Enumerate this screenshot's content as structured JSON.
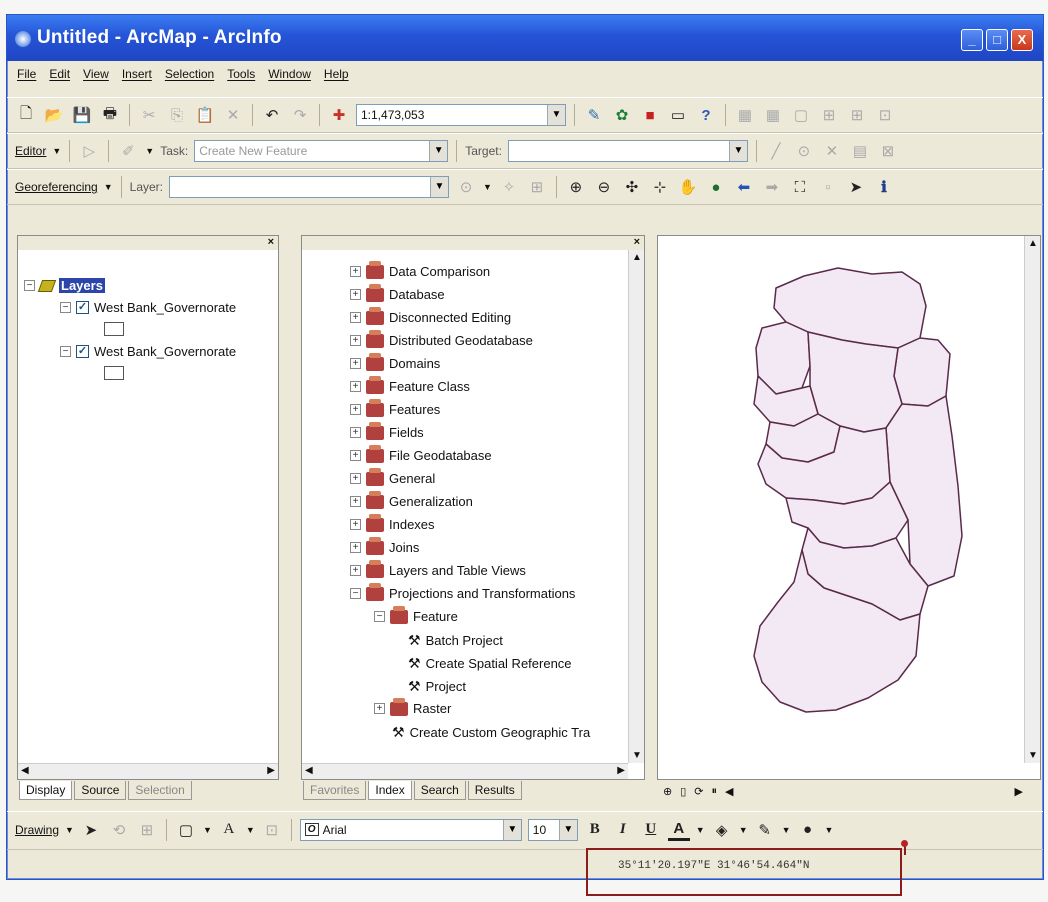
{
  "window": {
    "title": "Untitled - ArcMap - ArcInfo",
    "buttons": [
      "_",
      "□",
      "X"
    ]
  },
  "menu": [
    "File",
    "Edit",
    "View",
    "Insert",
    "Selection",
    "Tools",
    "Window",
    "Help"
  ],
  "standard_toolbar": {
    "scale": "1:1,473,053"
  },
  "editor_toolbar": {
    "editor_label": "Editor",
    "task_label": "Task:",
    "task_value": "Create New Feature",
    "target_label": "Target:",
    "target_value": ""
  },
  "georef_toolbar": {
    "label": "Georeferencing",
    "layer_label": "Layer:",
    "layer_value": ""
  },
  "toc": {
    "root": "Layers",
    "layers": [
      {
        "name": "West Bank_Governorate",
        "checked": true
      },
      {
        "name": "West Bank_Governorate",
        "checked": true
      }
    ],
    "tabs": [
      "Display",
      "Source",
      "Selection"
    ]
  },
  "toolbox": {
    "items": [
      "Data Comparison",
      "Database",
      "Disconnected Editing",
      "Distributed Geodatabase",
      "Domains",
      "Feature Class",
      "Features",
      "Fields",
      "File Geodatabase",
      "General",
      "Generalization",
      "Indexes",
      "Joins",
      "Layers and Table Views",
      "Projections and Transformations"
    ],
    "feature_folder": "Feature",
    "feature_tools": [
      "Batch Project",
      "Create Spatial Reference",
      "Project"
    ],
    "after": [
      "Raster",
      "Create Custom Geographic Tra"
    ],
    "tabs": [
      "Favorites",
      "Index",
      "Search",
      "Results"
    ]
  },
  "drawing_toolbar": {
    "label": "Drawing",
    "font": "Arial",
    "size": "10",
    "bold": "B",
    "italic": "I",
    "underline": "U",
    "font_color_glyph": "A"
  },
  "status": {
    "coordinates": "35°11'20.197\"E  31°46'54.464\"N"
  },
  "colors": {
    "title_bar": "#245edb",
    "map_fill": "#f3e9f4",
    "highlight": "#8d1c1c"
  }
}
